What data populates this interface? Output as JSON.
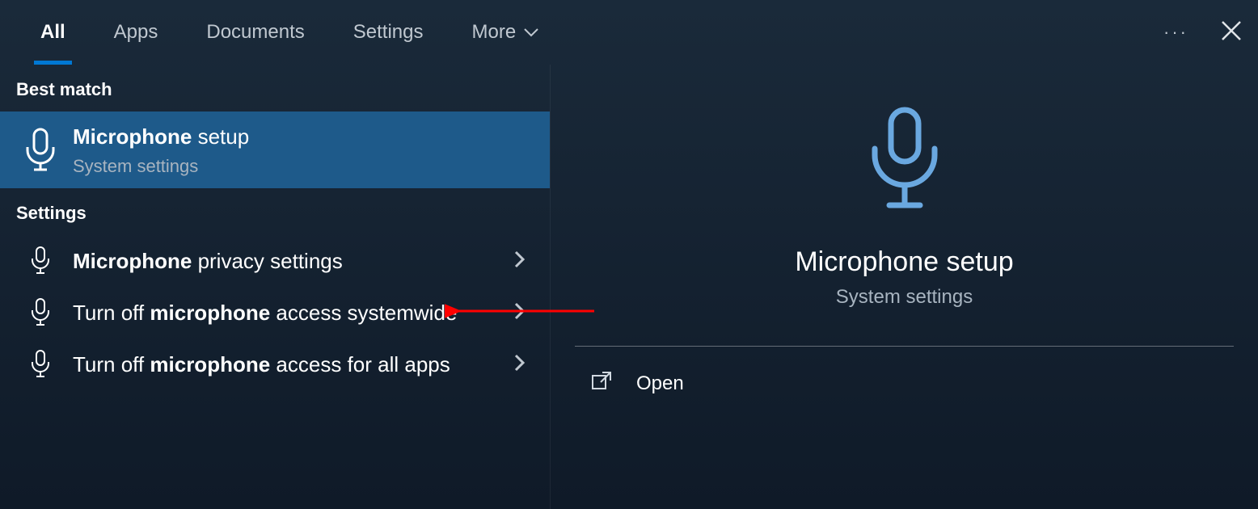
{
  "tabs": {
    "all": "All",
    "apps": "Apps",
    "documents": "Documents",
    "settings": "Settings",
    "more": "More"
  },
  "sections": {
    "best_match": "Best match",
    "settings": "Settings"
  },
  "best_match": {
    "title_bold": "Microphone",
    "title_rest": " setup",
    "subtitle": "System settings"
  },
  "settings_results": [
    {
      "bold": "Microphone",
      "rest": " privacy settings"
    },
    {
      "pre": "Turn off ",
      "bold": "microphone",
      "rest": " access systemwide"
    },
    {
      "pre": "Turn off ",
      "bold": "microphone",
      "rest": " access for all apps"
    }
  ],
  "detail": {
    "title": "Microphone setup",
    "subtitle": "System settings",
    "open": "Open"
  }
}
